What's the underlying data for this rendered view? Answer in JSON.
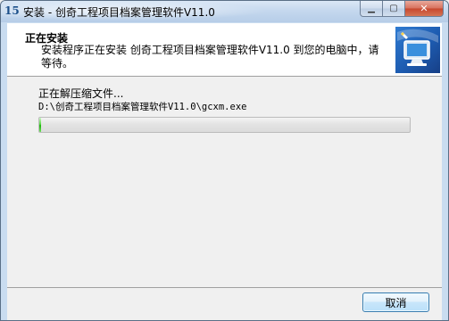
{
  "window": {
    "title": "安装 - 创奇工程项目档案管理软件V11.0",
    "app_icon_glyph": "15",
    "caption_buttons": {
      "minimize_glyph": "▁",
      "maximize_glyph": "▢",
      "close_glyph": "✕"
    }
  },
  "header": {
    "title": "正在安装",
    "description": "安装程序正在安装 创奇工程项目档案管理软件V11.0 到您的电脑中，请等待。"
  },
  "body": {
    "status_text": "正在解压缩文件...",
    "file_path": "D:\\创奇工程项目档案管理软件V11.0\\gcxm.exe",
    "progress_fraction": 0.005
  },
  "buttons": {
    "cancel_label": "取消"
  },
  "colors": {
    "titlebar": "#c5d8ee",
    "progress_green": "#22b30f",
    "header_background": "#ffffff",
    "client_background": "#f0f0f0"
  }
}
